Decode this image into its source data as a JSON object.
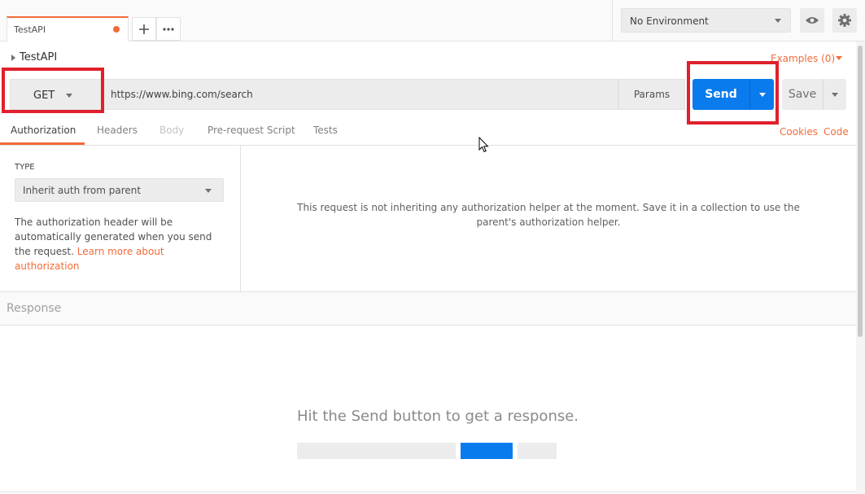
{
  "tabs": {
    "active_tab": "TestAPI",
    "new_tab_icon": "plus-icon",
    "more_icon": "ellipsis-icon"
  },
  "environment": {
    "selected": "No Environment",
    "quick_look_icon": "eye-icon",
    "settings_icon": "gear-icon"
  },
  "request": {
    "name": "TestAPI",
    "examples_label": "Examples (0)",
    "method": "GET",
    "url": "https://www.bing.com/search",
    "params_label": "Params",
    "send_label": "Send",
    "save_label": "Save"
  },
  "subtabs": {
    "items": [
      "Authorization",
      "Headers",
      "Body",
      "Pre-request Script",
      "Tests"
    ],
    "active": "Authorization",
    "cookies_label": "Cookies",
    "code_label": "Code"
  },
  "auth": {
    "type_heading": "TYPE",
    "type_value": "Inherit auth from parent",
    "description": "The authorization header will be automatically generated when you send the request.",
    "learn_more": "Learn more about authorization",
    "message": "This request is not inheriting any authorization helper at the moment. Save it in a collection to use the parent's authorization helper."
  },
  "response": {
    "heading": "Response",
    "empty_message": "Hit the Send button to get a response."
  },
  "colors": {
    "accent": "#f26b3a",
    "send_blue": "#097bed",
    "highlight_red": "#e0202c"
  }
}
